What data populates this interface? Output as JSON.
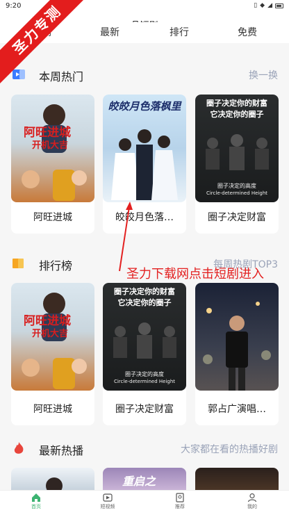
{
  "status_bar": {
    "time": "9:20"
  },
  "header": {
    "title": "晶短剧"
  },
  "categories": [
    "悦剧",
    "最新",
    "排行",
    "免费"
  ],
  "watermark": {
    "text": "圣力专测",
    "color": "#e31d1d"
  },
  "annotation": {
    "text": "圣力下载网点击短剧进入",
    "color": "#e32020"
  },
  "weekly_hot": {
    "title": "本周热门",
    "action": "换一换",
    "items": [
      {
        "title": "阿旺进城",
        "poster_lines": [
          "阿旺进城",
          "开机大吉"
        ]
      },
      {
        "title": "皎皎月色落…",
        "poster_lines": [
          "皎皎月色落枫里"
        ]
      },
      {
        "title": "圈子决定财富",
        "poster_lines": [
          "圈子决定你的财富",
          "它决定你的圈子",
          "圈子决定的高度",
          "Circle-determined Height"
        ]
      }
    ]
  },
  "ranking": {
    "title": "排行榜",
    "action": "每周热剧TOP3",
    "items": [
      {
        "title": "阿旺进城",
        "poster_lines": [
          "阿旺进城",
          "开机大吉"
        ]
      },
      {
        "title": "圈子决定财富",
        "poster_lines": [
          "圈子决定你的财富",
          "它决定你的圈子",
          "圈子决定的高度",
          "Circle-determined Height"
        ]
      },
      {
        "title": "郭占广演唱…",
        "poster_lines": []
      }
    ]
  },
  "latest": {
    "title": "最新热播",
    "action": "大家都在看的热播好剧",
    "preview_lines": [
      "重启之"
    ]
  },
  "tabs": [
    {
      "label": "首页",
      "icon": "home-icon",
      "active": true
    },
    {
      "label": "短视频",
      "icon": "video-icon",
      "active": false
    },
    {
      "label": "推荐",
      "icon": "recommend-icon",
      "active": false
    },
    {
      "label": "我的",
      "icon": "profile-icon",
      "active": false
    }
  ],
  "colors": {
    "accent": "#3cb371",
    "secondary_text": "#9aa3b8"
  }
}
